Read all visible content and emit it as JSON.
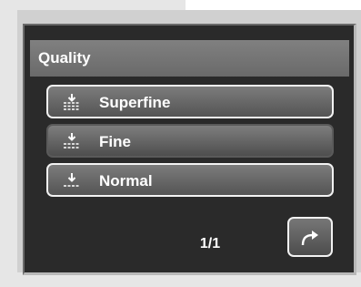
{
  "menu": {
    "title": "Quality",
    "options": [
      {
        "label": "Superfine",
        "icon": "quality-superfine-icon",
        "selected": false
      },
      {
        "label": "Fine",
        "icon": "quality-fine-icon",
        "selected": true
      },
      {
        "label": "Normal",
        "icon": "quality-normal-icon",
        "selected": false
      }
    ],
    "page_indicator": "1/1",
    "return_icon": "return-arrow-icon"
  },
  "colors": {
    "lcd_background": "#2a2a2a",
    "title_bar": "#787878",
    "button_fill": "#666666",
    "button_border": "#f2f2f2",
    "text": "#ffffff"
  }
}
